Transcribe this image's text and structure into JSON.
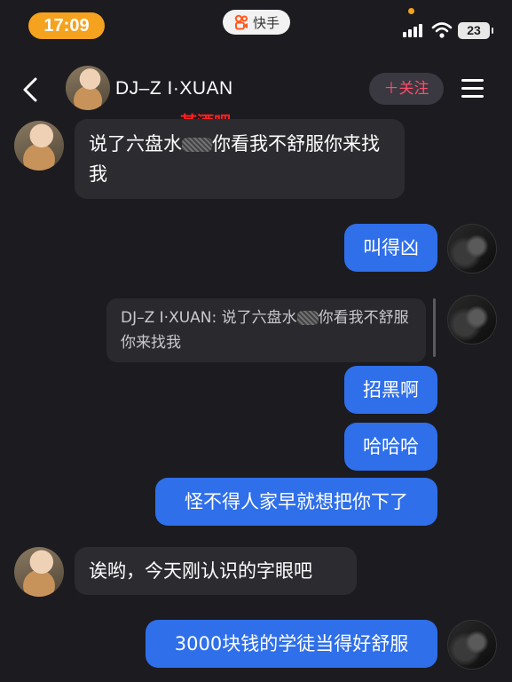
{
  "status_bar": {
    "time": "17:09",
    "app_name": "快手",
    "battery": "23"
  },
  "header": {
    "contact_name": "DJ–Z I·XUAN",
    "follow_label": "＋关注"
  },
  "annotation": "某酒吧",
  "messages": [
    {
      "from": "contact",
      "text_a": "说了六盘水",
      "text_b": "你看我不舒服你来找我"
    },
    {
      "from": "me",
      "text": "叫得凶"
    },
    {
      "from": "me",
      "quote_a": "DJ–Z I·XUAN: 说了六盘水",
      "quote_b": "你看我不舒服你来找我"
    },
    {
      "from": "me",
      "text": "招黑啊"
    },
    {
      "from": "me",
      "text": "哈哈哈"
    },
    {
      "from": "me",
      "text": "怪不得人家早就想把你下了"
    },
    {
      "from": "contact",
      "text": "诶哟，今天刚认识的字眼吧"
    },
    {
      "from": "me",
      "text": "3000块钱的学徒当得好舒服"
    }
  ],
  "colors": {
    "background": "#1c1b20",
    "outgoing_bubble": "#2f6fea",
    "incoming_bubble": "#2c2b30",
    "follow_text": "#ff4c6a",
    "time_pill": "#f5a21f"
  }
}
